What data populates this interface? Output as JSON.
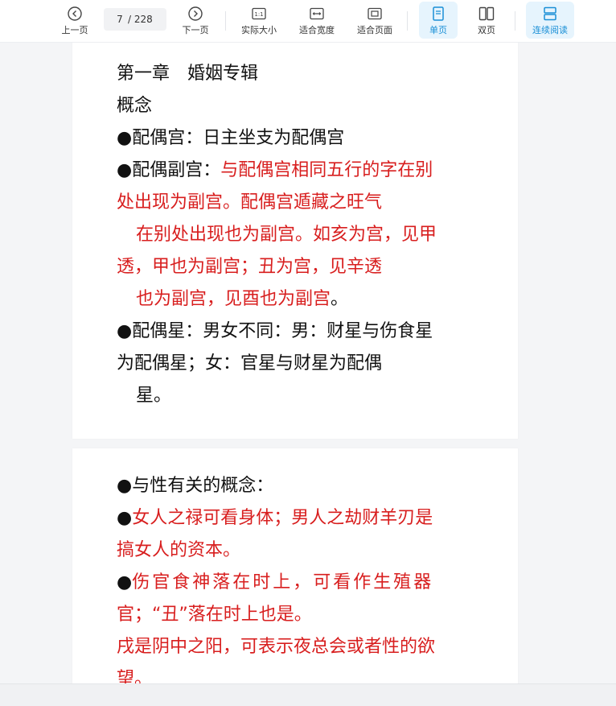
{
  "toolbar": {
    "prev_label": "上一页",
    "next_label": "下一页",
    "current_page": "7",
    "total_pages": "/ 228",
    "actual_size_label": "实际大小",
    "fit_width_label": "适合宽度",
    "fit_page_label": "适合页面",
    "single_page_label": "单页",
    "double_page_label": "双页",
    "continuous_label": "连续阅读",
    "accent_color": "#1a8fd6"
  },
  "page1": {
    "title": "第一章　婚姻专辑",
    "concept": "概念",
    "p1_bullet": "●",
    "p1_text": "配偶宫：日主坐支为配偶宫",
    "p2_bullet": "●",
    "p2_label": "配偶副宫：",
    "p2_red_1": "与配偶宫相同五行的字在别",
    "p2_red_2": "处出现为副宫。配偶宫遁藏之旺气",
    "p2_red_3": "在别处出现也为副宫。如亥为宫，见甲",
    "p2_red_4": "透，甲也为副宫；丑为宫，见辛透",
    "p2_red_5": "也为副宫，见酉也为副宫",
    "p2_end": "。",
    "p3_bullet": "●",
    "p3_line1": "配偶星：男女不同：男：财星与伤食星",
    "p3_line2": "为配偶星；女：官星与财星为配偶",
    "p3_line3": "星。"
  },
  "page2": {
    "l1": "●与性有关的概念：",
    "l2_bullet": "●",
    "l2_red": "女人之禄可看身体；男人之劫财羊刃是",
    "l3_red": "搞女人的资本。",
    "l4_bullet": "●",
    "l4_red": "伤官食神落在时上，可看作生殖器",
    "l5_red": "官；“丑”落在时上也是。",
    "l6_red": "戌是阴中之阳，可表示夜总会或者性的欲",
    "l7_red": "望。"
  },
  "colors": {
    "red_text": "#d81e1e",
    "body_text": "#111111"
  }
}
